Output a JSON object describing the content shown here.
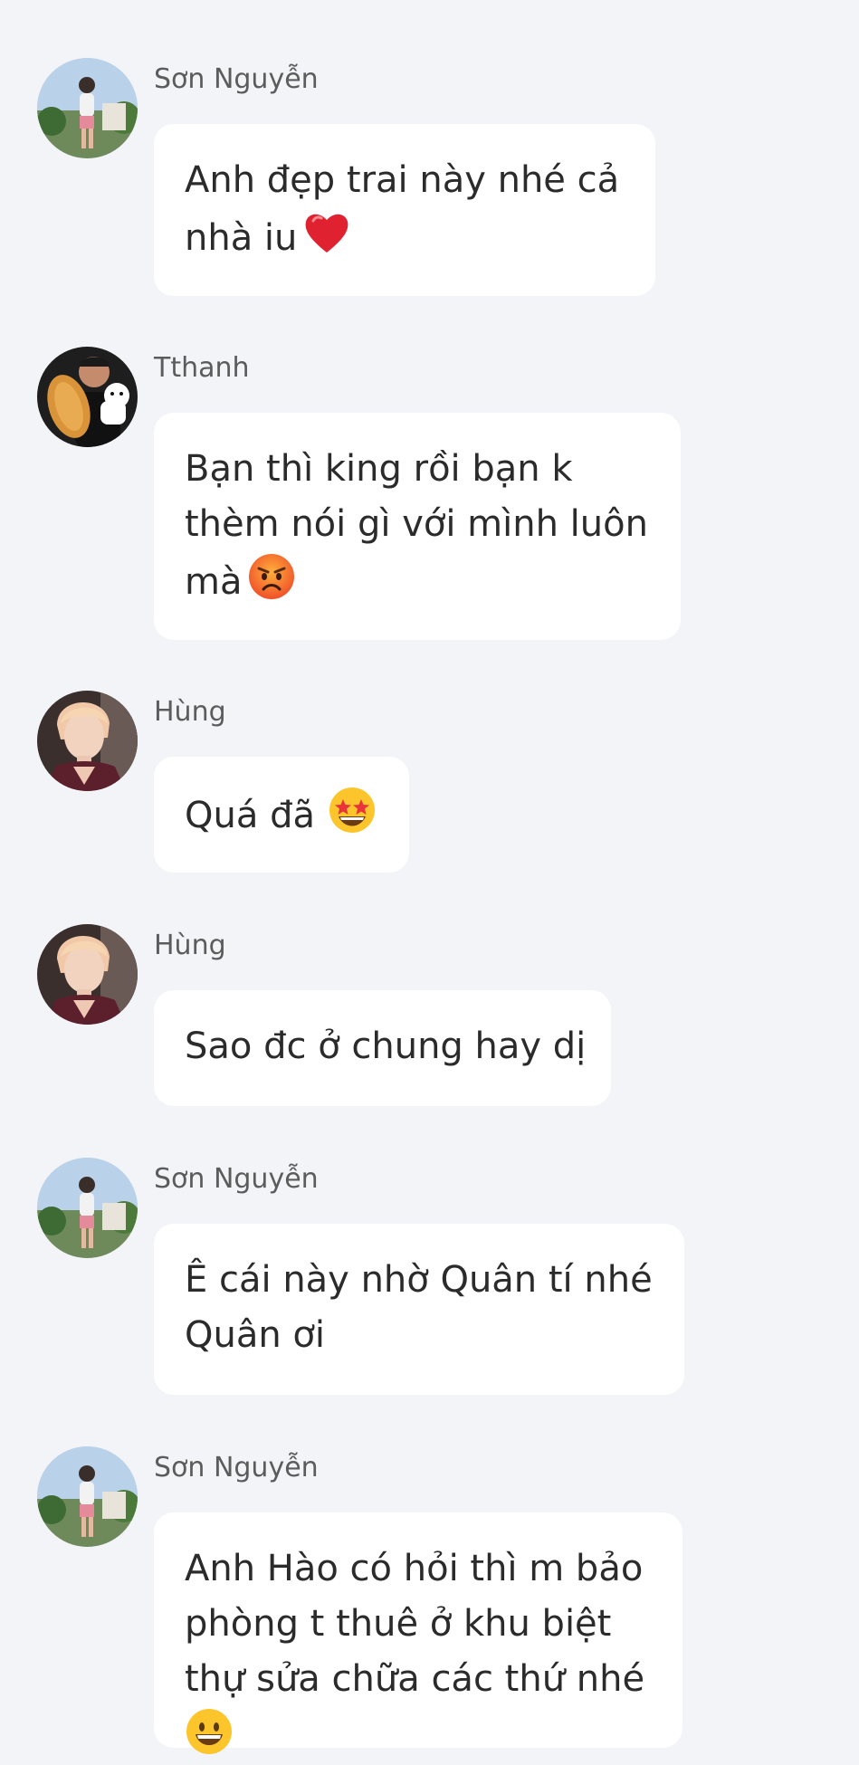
{
  "messages": [
    {
      "sender": "Sơn Nguyễn",
      "avatar_icon": "avatar-son-nguyen-icon",
      "lines": [
        "Anh đẹp trai này nhé cả",
        "nhà iu"
      ],
      "emoji": "red-heart-icon"
    },
    {
      "sender": "Tthanh",
      "avatar_icon": "avatar-tthanh-icon",
      "lines": [
        "Bạn thì king rồi bạn k",
        "thèm nói gì với mình luôn",
        "mà"
      ],
      "emoji": "angry-face-icon"
    },
    {
      "sender": "Hùng",
      "avatar_icon": "avatar-hung-icon",
      "lines": [
        "Quá đã"
      ],
      "emoji": "star-struck-face-icon"
    },
    {
      "sender": "Hùng",
      "avatar_icon": "avatar-hung-icon",
      "lines": [
        "Sao đc ở chung hay dị"
      ]
    },
    {
      "sender": "Sơn Nguyễn",
      "avatar_icon": "avatar-son-nguyen-icon",
      "lines": [
        "Ê cái này nhờ Quân tí nhé",
        "Quân ơi"
      ]
    },
    {
      "sender": "Sơn Nguyễn",
      "avatar_icon": "avatar-son-nguyen-icon",
      "lines": [
        "Anh Hào có hỏi thì m bảo",
        "phòng t thuê ở khu biệt",
        "thự sửa chữa các thứ nhé"
      ],
      "emoji": "grinning-face-icon"
    }
  ],
  "colors": {
    "background": "#f3f4f8",
    "bubble": "#ffffff",
    "text": "#2b2b2b",
    "sender": "#5c5c5c"
  }
}
